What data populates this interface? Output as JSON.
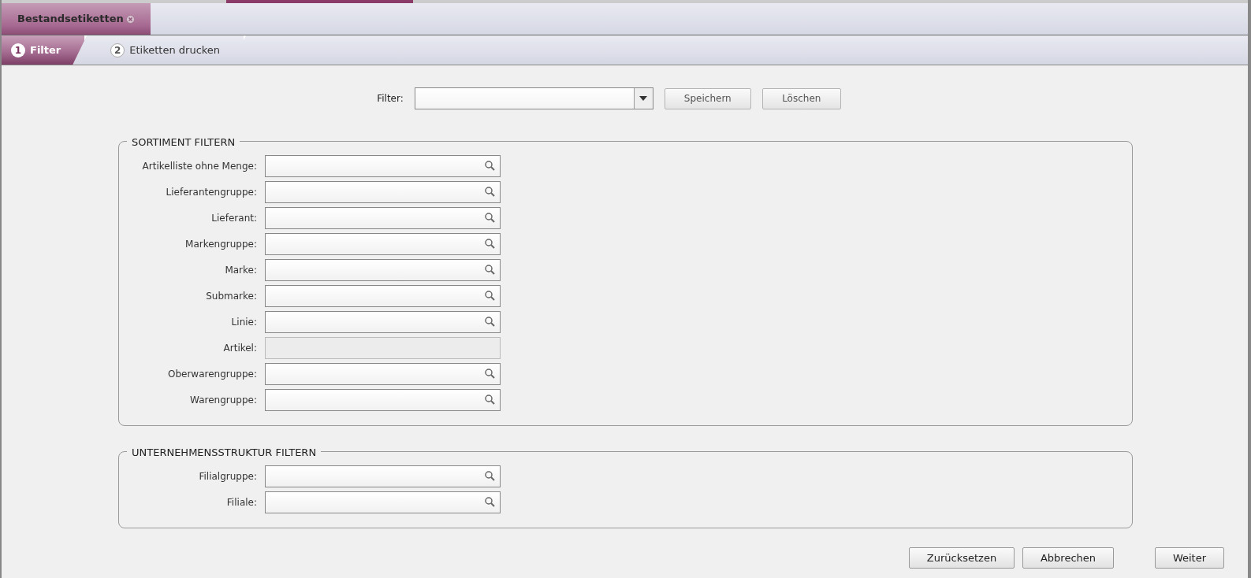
{
  "document_tabs": [
    {
      "label": "Bestandsetiketten",
      "selected": true
    }
  ],
  "steps": [
    {
      "number": "1",
      "label": "Filter",
      "selected": true
    },
    {
      "number": "2",
      "label": "Etiketten drucken",
      "selected": false
    }
  ],
  "filter_bar": {
    "label": "Filter:",
    "buttons": [
      "Speichern",
      "Löschen"
    ]
  },
  "groups": [
    {
      "title": "SORTIMENT FILTERN",
      "fields": [
        {
          "label": "Artikelliste ohne Menge:",
          "disabled": false
        },
        {
          "label": "Lieferantengruppe:",
          "disabled": false
        },
        {
          "label": "Lieferant:",
          "disabled": false
        },
        {
          "label": "Markengruppe:",
          "disabled": false
        },
        {
          "label": "Marke:",
          "disabled": false
        },
        {
          "label": "Submarke:",
          "disabled": false
        },
        {
          "label": "Linie:",
          "disabled": false
        },
        {
          "label": "Artikel:",
          "disabled": true
        },
        {
          "label": "Oberwarengruppe:",
          "disabled": false
        },
        {
          "label": "Warengruppe:",
          "disabled": false
        }
      ]
    },
    {
      "title": "UNTERNEHMENSSTRUKTUR FILTERN",
      "fields": [
        {
          "label": "Filialgruppe:",
          "disabled": false
        },
        {
          "label": "Filiale:",
          "disabled": false
        }
      ]
    }
  ],
  "footer_buttons": [
    {
      "label": "Zurücksetzen",
      "kind": "secondary"
    },
    {
      "label": "Abbrechen",
      "kind": "secondary"
    },
    {
      "label": "Weiter",
      "kind": "primary"
    }
  ]
}
